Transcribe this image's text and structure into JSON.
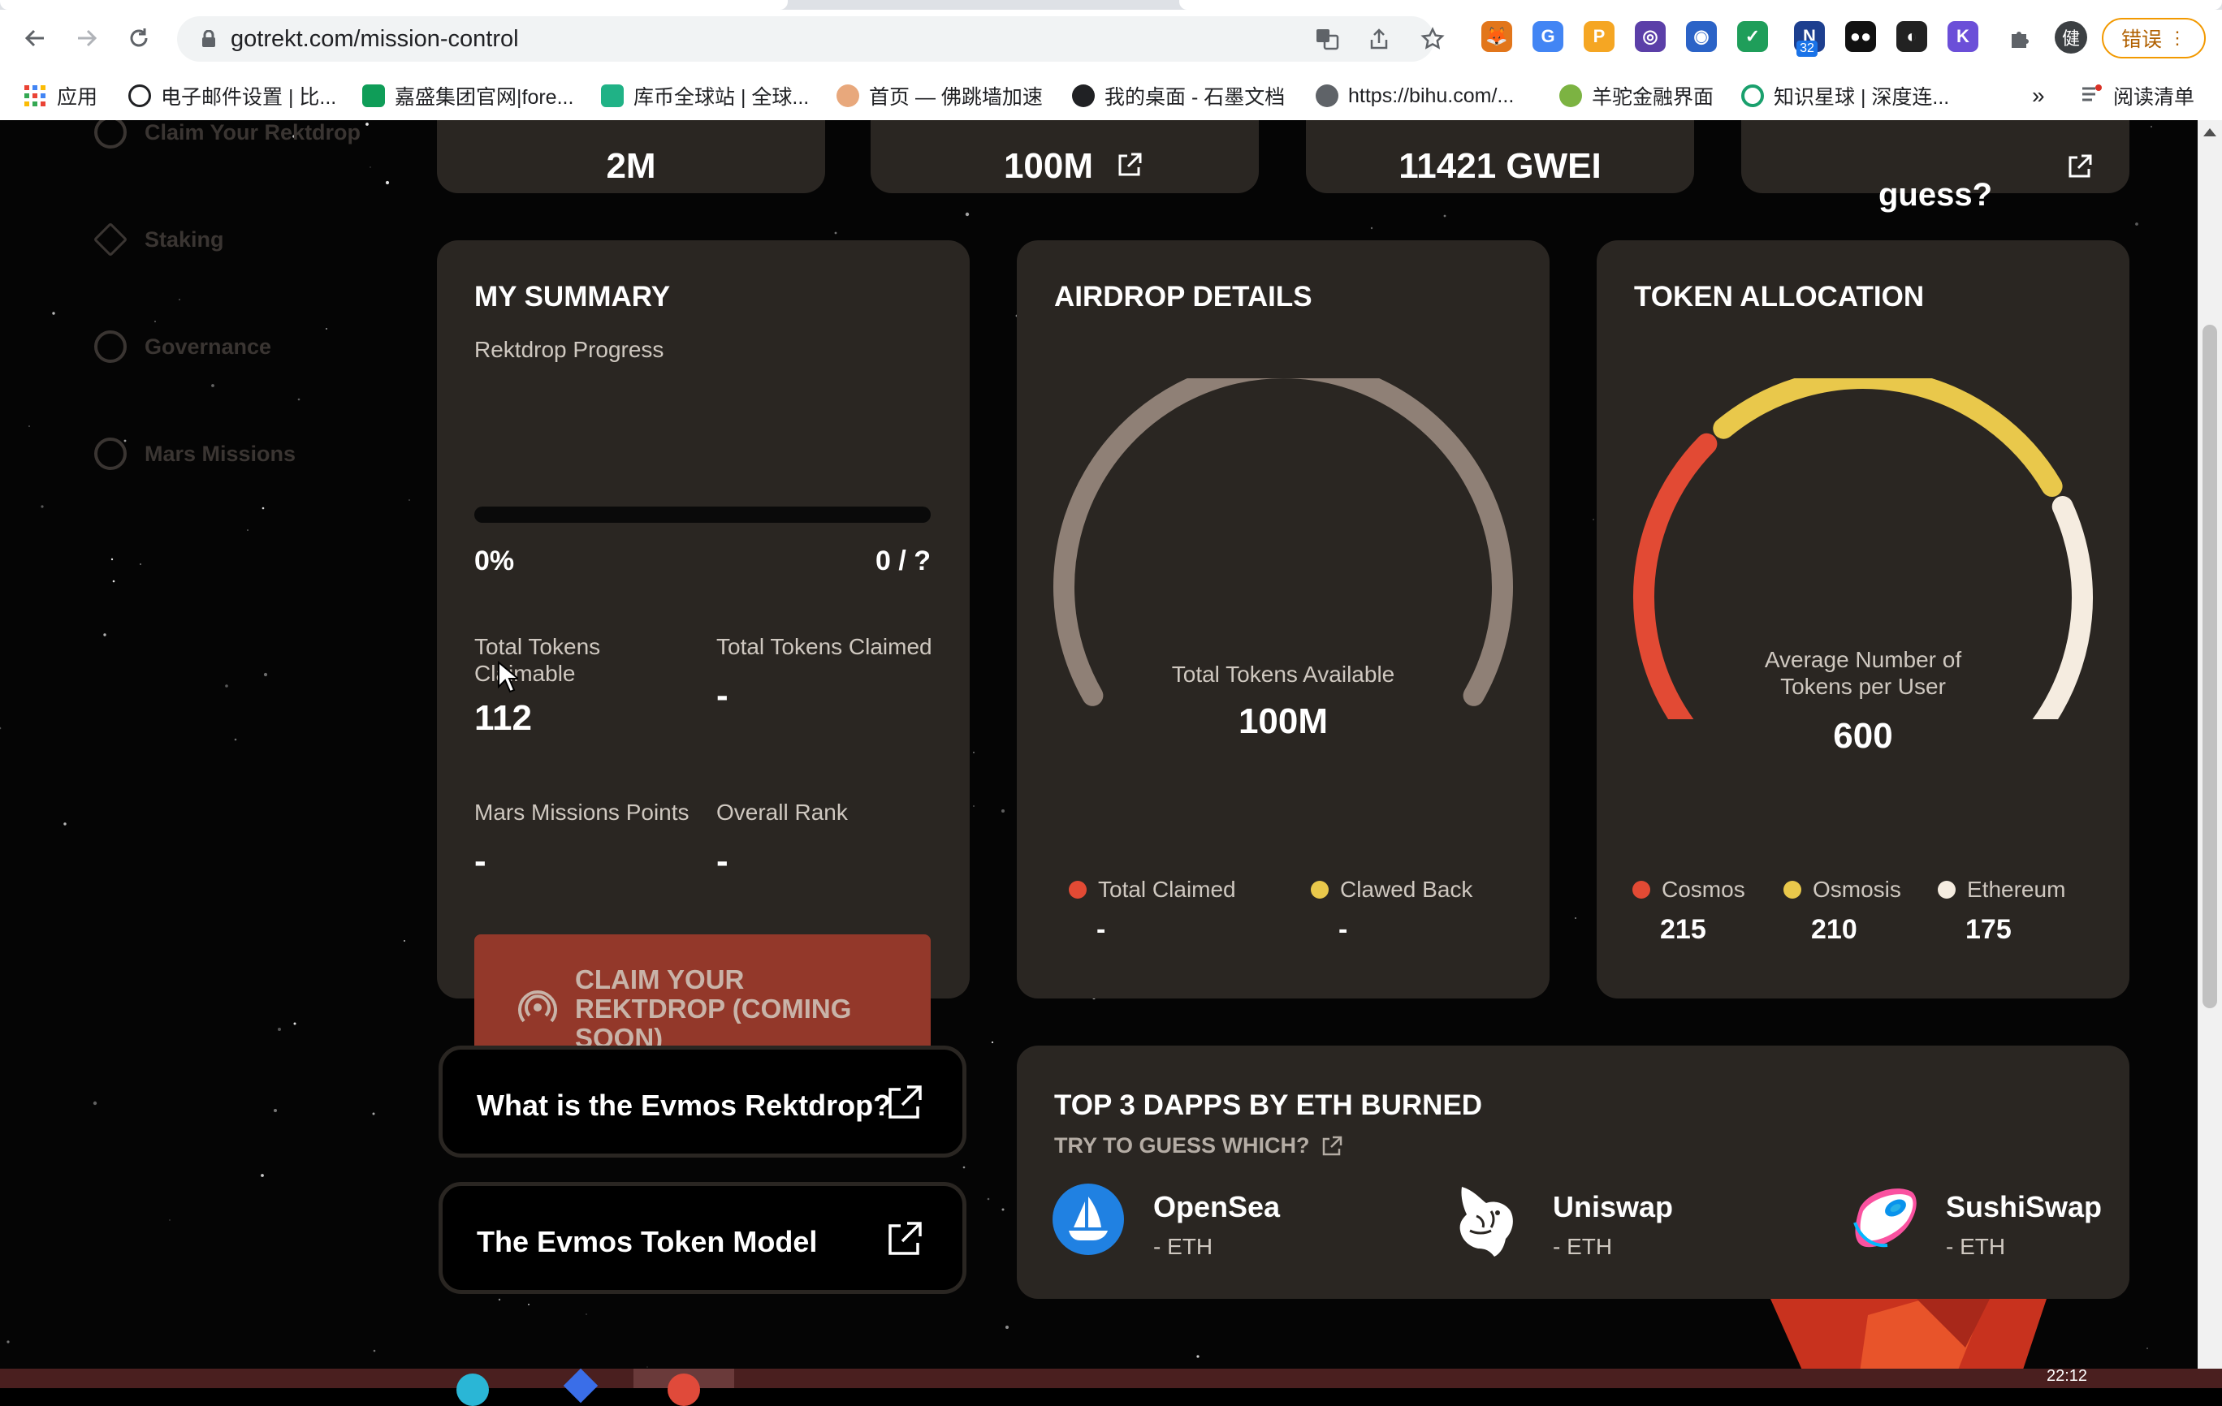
{
  "browser": {
    "url": "gotrekt.com/mission-control",
    "error_button": "错误",
    "extensions": [
      {
        "name": "metamask-fox-icon",
        "color": "#e2761b",
        "text": "🦊"
      },
      {
        "name": "translate-extension-icon",
        "color": "#4285f4",
        "text": "G"
      },
      {
        "name": "orange-p-extension-icon",
        "color": "#f5a623",
        "text": "P"
      },
      {
        "name": "purple-ring-extension-icon",
        "color": "#5b3fa8",
        "text": "◎"
      },
      {
        "name": "blue-chat-extension-icon",
        "color": "#2b63c7",
        "text": "◉"
      },
      {
        "name": "green-leaf-extension-icon",
        "color": "#1f9e5a",
        "text": "✓"
      },
      {
        "name": "dict-extension-icon",
        "color": "#1d3f8f",
        "text": "N"
      },
      {
        "name": "black-bear-extension-icon",
        "color": "#111111",
        "text": "●●"
      },
      {
        "name": "dark-swirl-extension-icon",
        "color": "#222222",
        "text": "◐"
      },
      {
        "name": "purple-k-extension-icon",
        "color": "#6b4fd8",
        "text": "K"
      }
    ],
    "ext_badge": "32",
    "profile_initial": "健",
    "bookmarks": [
      {
        "label": "应用",
        "color": "#ea4335"
      },
      {
        "label": "电子邮件设置 | 比...",
        "color": "#202124"
      },
      {
        "label": "嘉盛集团官网|fore...",
        "color": "#0f9d58"
      },
      {
        "label": "库币全球站 | 全球...",
        "color": "#20b286"
      },
      {
        "label": "首页 — 佛跳墙加速",
        "color": "#e8a87c"
      },
      {
        "label": "我的桌面 - 石墨文档",
        "color": "#202124"
      },
      {
        "label": "https://bihu.com/...",
        "color": "#5f6368"
      },
      {
        "label": "羊驼金融界面",
        "color": "#7cb342"
      },
      {
        "label": "知识星球 | 深度连...",
        "color": "#1aa06d"
      }
    ],
    "bookmarks_more": "»",
    "reading_list": "阅读清单"
  },
  "sidebar": {
    "items": [
      {
        "label": "Claim Your Rektdrop"
      },
      {
        "label": "Staking"
      },
      {
        "label": "Governance"
      },
      {
        "label": "Mars Missions"
      }
    ]
  },
  "top_stats": {
    "items": [
      {
        "value": "2M"
      },
      {
        "value": "100M"
      },
      {
        "value": "11421 GWEI"
      },
      {
        "value": "guess?"
      }
    ]
  },
  "summary": {
    "title": "MY SUMMARY",
    "progress_label": "Rektdrop Progress",
    "progress_fraction": 0,
    "percent": "0%",
    "ratio": "0 / ?",
    "claimable_label": "Total Tokens Claimable",
    "claimable_value": "112",
    "claimed_label": "Total Tokens Claimed",
    "claimed_value": "-",
    "mars_label": "Mars Missions Points",
    "mars_value": "-",
    "rank_label": "Overall Rank",
    "rank_value": "-",
    "claim_button": "CLAIM YOUR REKTDROP (COMING SOON)"
  },
  "airdrop": {
    "title": "AIRDROP DETAILS",
    "center_label": "Total Tokens Available",
    "center_value": "100M",
    "legend": [
      {
        "label": "Total Claimed",
        "value": "-",
        "color": "#e24a34"
      },
      {
        "label": "Clawed Back",
        "value": "-",
        "color": "#e9c84b"
      }
    ]
  },
  "allocation": {
    "title": "TOKEN ALLOCATION",
    "center_label": "Average Number of Tokens per User",
    "center_value": "600",
    "legend": [
      {
        "label": "Cosmos",
        "value": "215",
        "color": "#e24a34"
      },
      {
        "label": "Osmosis",
        "value": "210",
        "color": "#e9c84b"
      },
      {
        "label": "Ethereum",
        "value": "175",
        "color": "#f5ece0"
      }
    ]
  },
  "links": {
    "rektdrop": "What is the Evmos Rektdrop?",
    "token_model": "The Evmos Token Model"
  },
  "dapps": {
    "title": "TOP 3 DAPPS BY ETH BURNED",
    "subtitle": "TRY TO GUESS WHICH?",
    "items": [
      {
        "name": "OpenSea",
        "sub": "- ETH"
      },
      {
        "name": "Uniswap",
        "sub": "- ETH"
      },
      {
        "name": "SushiSwap",
        "sub": "- ETH"
      }
    ]
  },
  "taskbar": {
    "clock": "22:12"
  }
}
